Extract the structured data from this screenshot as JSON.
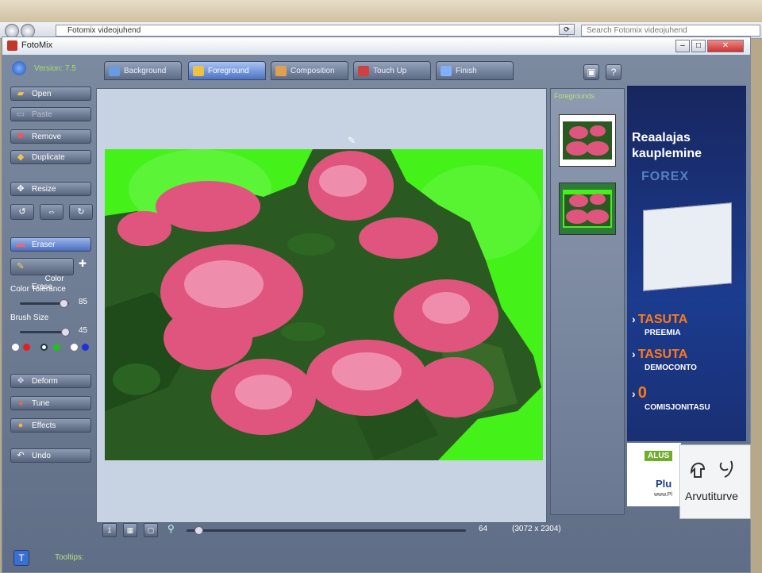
{
  "browser": {
    "address": "Fotomix videojuhend",
    "search_placeholder": "Search Fotomix videojuhend"
  },
  "window": {
    "title": "FotoMix",
    "version": "Version: 7.5"
  },
  "tabs": [
    {
      "label": "Background"
    },
    {
      "label": "Foreground"
    },
    {
      "label": "Composition"
    },
    {
      "label": "Touch Up"
    },
    {
      "label": "Finish"
    }
  ],
  "left_panel": {
    "open": "Open",
    "paste": "Paste",
    "remove": "Remove",
    "duplicate": "Duplicate",
    "resize": "Resize",
    "eraser": "Eraser",
    "color_erase": "Color\nErase",
    "color_tolerance_label": "Color Tolerance",
    "color_tolerance_value": "85",
    "brush_size_label": "Brush Size",
    "brush_size_value": "45",
    "deform": "Deform",
    "tune": "Tune",
    "effects": "Effects",
    "undo": "Undo"
  },
  "thumbs": {
    "header": "Foregrounds"
  },
  "bottom": {
    "zoom_value": "64",
    "dimensions": "(3072 x 2304)",
    "tooltips": "Tooltips:"
  },
  "ad": {
    "line1": "Reaalajas",
    "line2": "kauplemine",
    "line3": "FOREX",
    "item1_big": "TASUTA",
    "item1_small": "PREEMIA",
    "item2_big": "TASUTA",
    "item2_small": "DEMOCONTO",
    "item3_big": "0",
    "item3_small": "COMISJONITASU",
    "badge": "ALUS",
    "brand": "Plu",
    "url": "www.Pl"
  },
  "watermark": {
    "text": "Arvutiturve"
  },
  "colors": {
    "accent": "#4c72c4",
    "green_label": "#b8e27d",
    "ad_orange": "#ff7a1a"
  }
}
